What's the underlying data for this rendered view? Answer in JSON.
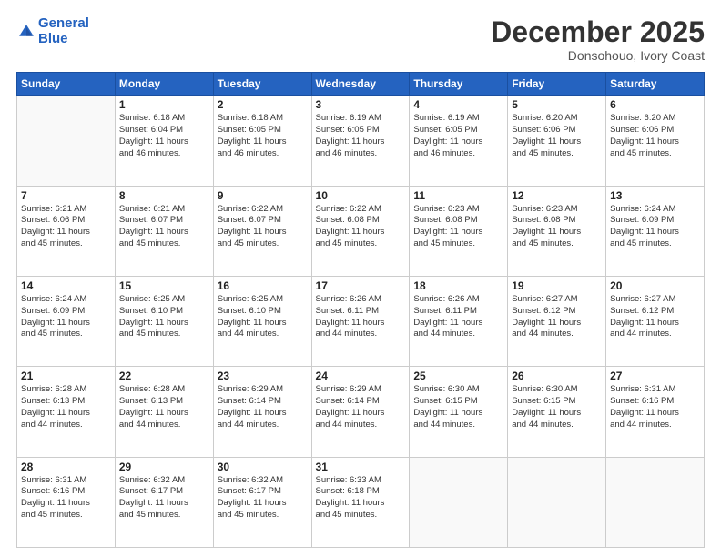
{
  "header": {
    "logo_line1": "General",
    "logo_line2": "Blue",
    "month": "December 2025",
    "location": "Donsohouo, Ivory Coast"
  },
  "weekdays": [
    "Sunday",
    "Monday",
    "Tuesday",
    "Wednesday",
    "Thursday",
    "Friday",
    "Saturday"
  ],
  "weeks": [
    [
      {
        "day": "",
        "info": ""
      },
      {
        "day": "1",
        "info": "Sunrise: 6:18 AM\nSunset: 6:04 PM\nDaylight: 11 hours\nand 46 minutes."
      },
      {
        "day": "2",
        "info": "Sunrise: 6:18 AM\nSunset: 6:05 PM\nDaylight: 11 hours\nand 46 minutes."
      },
      {
        "day": "3",
        "info": "Sunrise: 6:19 AM\nSunset: 6:05 PM\nDaylight: 11 hours\nand 46 minutes."
      },
      {
        "day": "4",
        "info": "Sunrise: 6:19 AM\nSunset: 6:05 PM\nDaylight: 11 hours\nand 46 minutes."
      },
      {
        "day": "5",
        "info": "Sunrise: 6:20 AM\nSunset: 6:06 PM\nDaylight: 11 hours\nand 45 minutes."
      },
      {
        "day": "6",
        "info": "Sunrise: 6:20 AM\nSunset: 6:06 PM\nDaylight: 11 hours\nand 45 minutes."
      }
    ],
    [
      {
        "day": "7",
        "info": "Sunrise: 6:21 AM\nSunset: 6:06 PM\nDaylight: 11 hours\nand 45 minutes."
      },
      {
        "day": "8",
        "info": "Sunrise: 6:21 AM\nSunset: 6:07 PM\nDaylight: 11 hours\nand 45 minutes."
      },
      {
        "day": "9",
        "info": "Sunrise: 6:22 AM\nSunset: 6:07 PM\nDaylight: 11 hours\nand 45 minutes."
      },
      {
        "day": "10",
        "info": "Sunrise: 6:22 AM\nSunset: 6:08 PM\nDaylight: 11 hours\nand 45 minutes."
      },
      {
        "day": "11",
        "info": "Sunrise: 6:23 AM\nSunset: 6:08 PM\nDaylight: 11 hours\nand 45 minutes."
      },
      {
        "day": "12",
        "info": "Sunrise: 6:23 AM\nSunset: 6:08 PM\nDaylight: 11 hours\nand 45 minutes."
      },
      {
        "day": "13",
        "info": "Sunrise: 6:24 AM\nSunset: 6:09 PM\nDaylight: 11 hours\nand 45 minutes."
      }
    ],
    [
      {
        "day": "14",
        "info": "Sunrise: 6:24 AM\nSunset: 6:09 PM\nDaylight: 11 hours\nand 45 minutes."
      },
      {
        "day": "15",
        "info": "Sunrise: 6:25 AM\nSunset: 6:10 PM\nDaylight: 11 hours\nand 45 minutes."
      },
      {
        "day": "16",
        "info": "Sunrise: 6:25 AM\nSunset: 6:10 PM\nDaylight: 11 hours\nand 44 minutes."
      },
      {
        "day": "17",
        "info": "Sunrise: 6:26 AM\nSunset: 6:11 PM\nDaylight: 11 hours\nand 44 minutes."
      },
      {
        "day": "18",
        "info": "Sunrise: 6:26 AM\nSunset: 6:11 PM\nDaylight: 11 hours\nand 44 minutes."
      },
      {
        "day": "19",
        "info": "Sunrise: 6:27 AM\nSunset: 6:12 PM\nDaylight: 11 hours\nand 44 minutes."
      },
      {
        "day": "20",
        "info": "Sunrise: 6:27 AM\nSunset: 6:12 PM\nDaylight: 11 hours\nand 44 minutes."
      }
    ],
    [
      {
        "day": "21",
        "info": "Sunrise: 6:28 AM\nSunset: 6:13 PM\nDaylight: 11 hours\nand 44 minutes."
      },
      {
        "day": "22",
        "info": "Sunrise: 6:28 AM\nSunset: 6:13 PM\nDaylight: 11 hours\nand 44 minutes."
      },
      {
        "day": "23",
        "info": "Sunrise: 6:29 AM\nSunset: 6:14 PM\nDaylight: 11 hours\nand 44 minutes."
      },
      {
        "day": "24",
        "info": "Sunrise: 6:29 AM\nSunset: 6:14 PM\nDaylight: 11 hours\nand 44 minutes."
      },
      {
        "day": "25",
        "info": "Sunrise: 6:30 AM\nSunset: 6:15 PM\nDaylight: 11 hours\nand 44 minutes."
      },
      {
        "day": "26",
        "info": "Sunrise: 6:30 AM\nSunset: 6:15 PM\nDaylight: 11 hours\nand 44 minutes."
      },
      {
        "day": "27",
        "info": "Sunrise: 6:31 AM\nSunset: 6:16 PM\nDaylight: 11 hours\nand 44 minutes."
      }
    ],
    [
      {
        "day": "28",
        "info": "Sunrise: 6:31 AM\nSunset: 6:16 PM\nDaylight: 11 hours\nand 45 minutes."
      },
      {
        "day": "29",
        "info": "Sunrise: 6:32 AM\nSunset: 6:17 PM\nDaylight: 11 hours\nand 45 minutes."
      },
      {
        "day": "30",
        "info": "Sunrise: 6:32 AM\nSunset: 6:17 PM\nDaylight: 11 hours\nand 45 minutes."
      },
      {
        "day": "31",
        "info": "Sunrise: 6:33 AM\nSunset: 6:18 PM\nDaylight: 11 hours\nand 45 minutes."
      },
      {
        "day": "",
        "info": ""
      },
      {
        "day": "",
        "info": ""
      },
      {
        "day": "",
        "info": ""
      }
    ]
  ]
}
